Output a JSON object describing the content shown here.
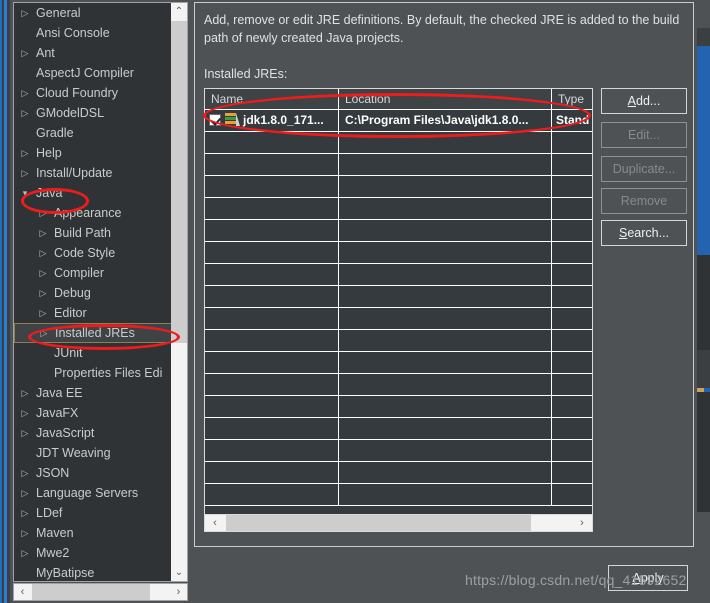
{
  "dialog": {
    "description": "Add, remove or edit JRE definitions. By default, the checked JRE is added to the build path of newly created Java projects.",
    "installed_jres_label": "Installed JREs:",
    "apply_label": "Apply"
  },
  "tree": {
    "items": [
      {
        "label": "General",
        "depth": 0,
        "arrow": "▷",
        "selected": false
      },
      {
        "label": "Ansi Console",
        "depth": 0,
        "arrow": "",
        "selected": false
      },
      {
        "label": "Ant",
        "depth": 0,
        "arrow": "▷",
        "selected": false
      },
      {
        "label": "AspectJ Compiler",
        "depth": 0,
        "arrow": "",
        "selected": false
      },
      {
        "label": "Cloud Foundry",
        "depth": 0,
        "arrow": "▷",
        "selected": false
      },
      {
        "label": "GModelDSL",
        "depth": 0,
        "arrow": "▷",
        "selected": false
      },
      {
        "label": "Gradle",
        "depth": 0,
        "arrow": "",
        "selected": false
      },
      {
        "label": "Help",
        "depth": 0,
        "arrow": "▷",
        "selected": false
      },
      {
        "label": "Install/Update",
        "depth": 0,
        "arrow": "▷",
        "selected": false
      },
      {
        "label": "Java",
        "depth": 0,
        "arrow": "▾",
        "selected": false
      },
      {
        "label": "Appearance",
        "depth": 1,
        "arrow": "▷",
        "selected": false
      },
      {
        "label": "Build Path",
        "depth": 1,
        "arrow": "▷",
        "selected": false
      },
      {
        "label": "Code Style",
        "depth": 1,
        "arrow": "▷",
        "selected": false
      },
      {
        "label": "Compiler",
        "depth": 1,
        "arrow": "▷",
        "selected": false
      },
      {
        "label": "Debug",
        "depth": 1,
        "arrow": "▷",
        "selected": false
      },
      {
        "label": "Editor",
        "depth": 1,
        "arrow": "▷",
        "selected": false
      },
      {
        "label": "Installed JREs",
        "depth": 1,
        "arrow": "▷",
        "selected": true
      },
      {
        "label": "JUnit",
        "depth": 1,
        "arrow": "",
        "selected": false
      },
      {
        "label": "Properties Files Edi",
        "depth": 1,
        "arrow": "",
        "selected": false
      },
      {
        "label": "Java EE",
        "depth": 0,
        "arrow": "▷",
        "selected": false
      },
      {
        "label": "JavaFX",
        "depth": 0,
        "arrow": "▷",
        "selected": false
      },
      {
        "label": "JavaScript",
        "depth": 0,
        "arrow": "▷",
        "selected": false
      },
      {
        "label": "JDT Weaving",
        "depth": 0,
        "arrow": "",
        "selected": false
      },
      {
        "label": "JSON",
        "depth": 0,
        "arrow": "▷",
        "selected": false
      },
      {
        "label": "Language Servers",
        "depth": 0,
        "arrow": "▷",
        "selected": false
      },
      {
        "label": "LDef",
        "depth": 0,
        "arrow": "▷",
        "selected": false
      },
      {
        "label": "Maven",
        "depth": 0,
        "arrow": "▷",
        "selected": false
      },
      {
        "label": "Mwe2",
        "depth": 0,
        "arrow": "▷",
        "selected": false
      },
      {
        "label": "MyBatipse",
        "depth": 0,
        "arrow": "",
        "selected": false
      }
    ],
    "scroll_up_icon": "⌃",
    "scroll_down_icon": "⌄",
    "scroll_left_icon": "‹",
    "scroll_right_icon": "›"
  },
  "table": {
    "columns": [
      "Name",
      "Location",
      "Type"
    ],
    "rows": [
      {
        "checked": true,
        "name": "jdk1.8.0_171...",
        "location": "C:\\Program Files\\Java\\jdk1.8.0...",
        "type": "Stand",
        "active": true
      }
    ],
    "empty_row_count": 17,
    "scroll_left_icon": "‹",
    "scroll_right_icon": "›"
  },
  "buttons": [
    {
      "label": "Add...",
      "mnemonic": "A",
      "enabled": true
    },
    {
      "label": "Edit...",
      "mnemonic": "E",
      "enabled": false
    },
    {
      "label": "Duplicate...",
      "mnemonic": "D",
      "enabled": false
    },
    {
      "label": "Remove",
      "mnemonic": "R",
      "enabled": false
    },
    {
      "label": "Search...",
      "mnemonic": "S",
      "enabled": true
    }
  ],
  "watermark": {
    "text": "https://blog.csdn.net/qq_41592652"
  },
  "annotations": {
    "color": "#ee1c1c",
    "shapes": [
      {
        "target": "java-tree-item",
        "kind": "ellipse"
      },
      {
        "target": "installed-jres-item",
        "kind": "ellipse"
      },
      {
        "target": "jre-table-row",
        "kind": "ellipse"
      }
    ]
  },
  "colors": {
    "dialog_bg": "#4e5254",
    "tree_bg": "#2f3336",
    "table_bg": "#343a3d",
    "text": "#dfe2e4",
    "accent_blue": "#2463b0",
    "annotation_red": "#ee1c1c"
  }
}
